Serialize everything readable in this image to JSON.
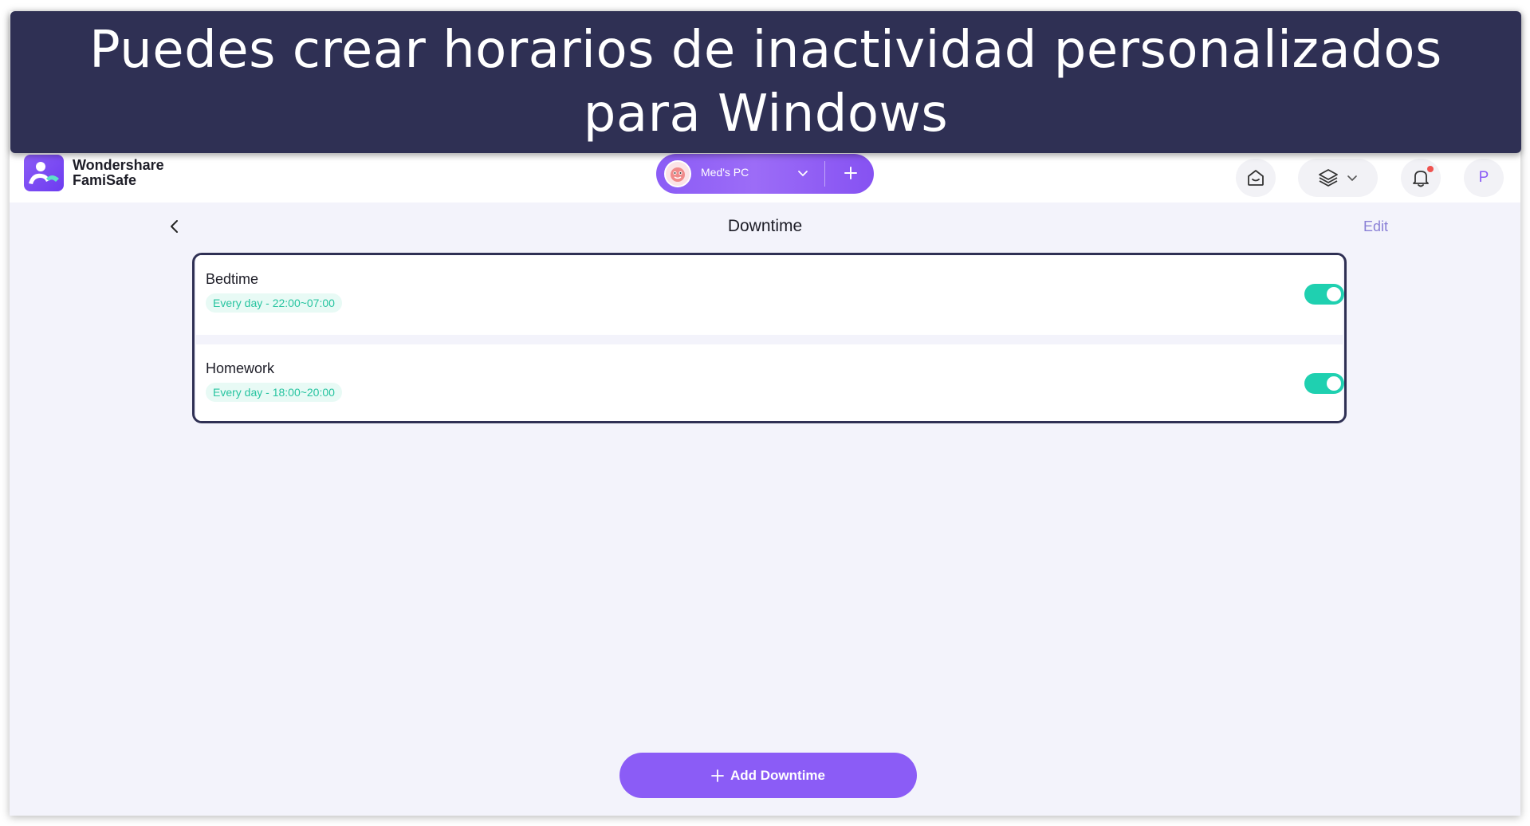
{
  "banner": {
    "line1": "Puedes crear horarios de inactividad personalizados",
    "line2": "para Windows"
  },
  "header": {
    "logo_line1": "Wondershare",
    "logo_line2": "FamiSafe",
    "device_name": "Med's PC",
    "profile_initial": "P",
    "icons": [
      "famisafe-logo-icon",
      "device-avatar-icon",
      "chevron-down-icon",
      "plus-icon",
      "home-icon",
      "layers-icon",
      "bell-icon"
    ]
  },
  "page": {
    "title": "Downtime",
    "edit_label": "Edit"
  },
  "downtimes": [
    {
      "name": "Bedtime",
      "schedule": "Every day - 22:00~07:00",
      "enabled": true
    },
    {
      "name": "Homework",
      "schedule": "Every day - 18:00~20:00",
      "enabled": true
    }
  ],
  "add_button": {
    "label": "Add Downtime"
  },
  "colors": {
    "accent": "#8b5cf6",
    "toggle_on": "#1fd0b0",
    "banner_bg": "#2f3054",
    "tag_text": "#27c4a0"
  }
}
